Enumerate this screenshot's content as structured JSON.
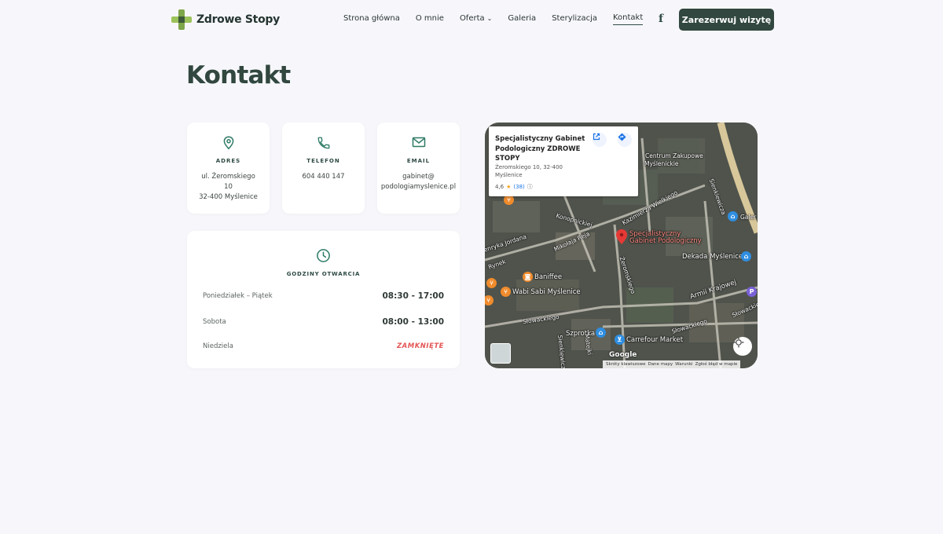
{
  "brand": {
    "name": "Zdrowe Stopy"
  },
  "nav": {
    "items": [
      {
        "label": "Strona główna"
      },
      {
        "label": "O mnie"
      },
      {
        "label": "Oferta"
      },
      {
        "label": "Galeria"
      },
      {
        "label": "Sterylizacja"
      },
      {
        "label": "Kontakt"
      }
    ],
    "active": "Kontakt",
    "facebook_glyph": "f",
    "cta_label": "Zarezerwuj wizytę"
  },
  "page": {
    "title": "Kontakt"
  },
  "contact": {
    "address": {
      "label": "ADRES",
      "line1": "ul. Żeromskiego",
      "line2": "10",
      "line3": "32-400 Myślenice",
      "icon": "map-pin-icon"
    },
    "phone": {
      "label": "TELEFON",
      "value": "604 440 147",
      "icon": "phone-icon"
    },
    "email": {
      "label": "EMAIL",
      "line1": "gabinet@",
      "line2": "podologiamyslenice.pl",
      "icon": "mail-icon"
    }
  },
  "hours": {
    "title": "GODZINY OTWARCIA",
    "icon": "clock-icon",
    "rows": [
      {
        "day": "Poniedziałek – Piątek",
        "time": "08:30 - 17:00"
      },
      {
        "day": "Sobota",
        "time": "08:00 - 13:00"
      },
      {
        "day": "Niedziela",
        "time": "ZAMKNIĘTE"
      }
    ],
    "closed_color": "#e45454"
  },
  "map": {
    "place": {
      "name": "Specjalistyczny Gabinet Podologiczny ZDROWE STOPY",
      "address": "Żeromskiego 10, 32-400 Myślenice",
      "rating": "4,6",
      "reviews": "(38)"
    },
    "labels": {
      "pin_line1": "Specjalistyczny",
      "pin_line2": "Gabinet Podologiczny",
      "dekada": "Dekada Myślenice",
      "armii": "Armii Krajowej",
      "baniffee": "Baniffee",
      "wabi": "Wabi Sabi Myślenice",
      "slowackiego1": "Słowackiego",
      "slowackiego2": "Słowackiego",
      "slowackiego3": "Słowackiego",
      "szprotka": "Szprotka",
      "carrefour": "Carrefour Market",
      "zeromskiego": "Żeromskiego",
      "mikolaja": "Mikołaja Reja",
      "konopnickiej": "Konopnickiej",
      "kazimierza": "Kazimierza Wielkiego",
      "jordana": "Henryka Jordana",
      "zakupowe": "Centrum Zakupowe",
      "myslenickie": "Myślenickie",
      "galeria": "Galer",
      "mateki": "Matejki",
      "sienkiewicza": "Sienkiewicza",
      "rynek": "Rynek",
      "skrzecza": "Sienkiewicza"
    },
    "google": "Google",
    "attribution": [
      "Skróty klawiszowe",
      "Dane mapy",
      "Warunki",
      "Zgłoś błąd w mapie"
    ]
  },
  "colors": {
    "brand_dark": "#31473f",
    "background": "#f7f7fb",
    "accent_green": "#2e7a66"
  }
}
